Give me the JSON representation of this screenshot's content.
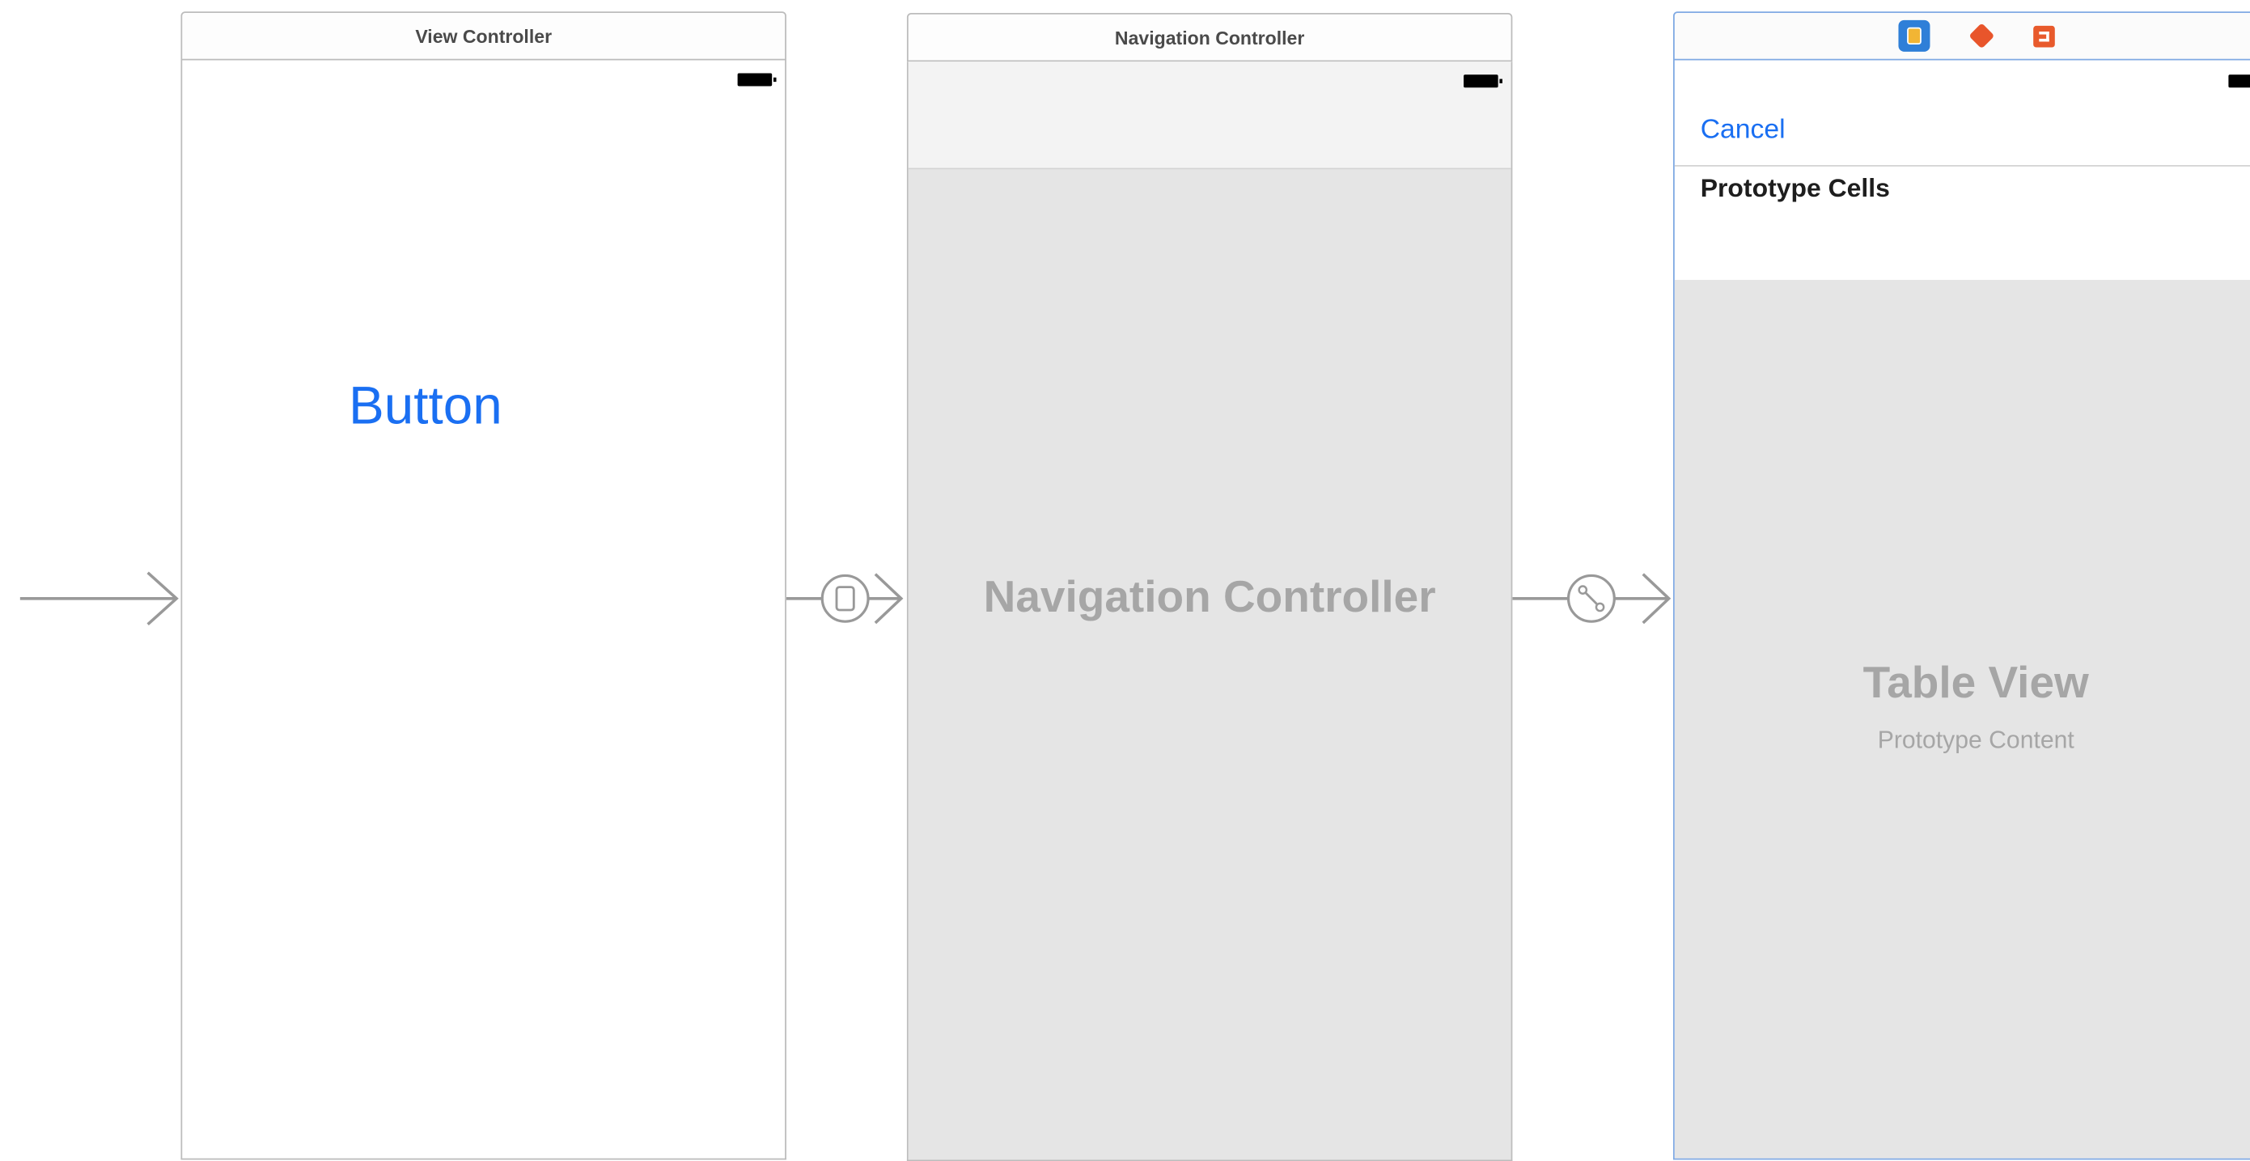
{
  "scenes": {
    "view_controller": {
      "title": "View Controller",
      "button_label": "Button"
    },
    "navigation_controller": {
      "title": "Navigation Controller",
      "placeholder_label": "Navigation Controller"
    },
    "table_view_controller": {
      "title_icons": [
        "view-controller-icon",
        "first-responder-icon",
        "exit-icon"
      ],
      "cancel_label": "Cancel",
      "prototype_cells_label": "Prototype Cells",
      "table_view_label": "Table View",
      "table_view_sublabel": "Prototype Content"
    }
  },
  "segues": [
    {
      "kind": "entry-point"
    },
    {
      "kind": "present-modally"
    },
    {
      "kind": "root-view-controller-relationship"
    }
  ],
  "colors": {
    "accent_blue": "#1a6ff2",
    "placeholder_gray": "#a6a6a6",
    "canvas_gray": "#e5e5e5",
    "selected_scene_border": "#7fa9e3",
    "connector_gray": "#999999"
  }
}
